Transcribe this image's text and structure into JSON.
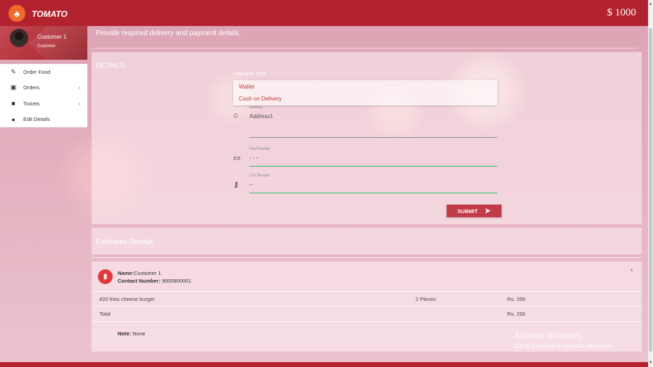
{
  "header": {
    "brand": "TOMATO",
    "balance": "$ 1000"
  },
  "profile": {
    "name": "Customer 1",
    "role": "Customer"
  },
  "sidebar": {
    "items": [
      {
        "label": "Order Food",
        "icon": "pencil-icon",
        "has_submenu": false
      },
      {
        "label": "Orders",
        "icon": "calendar-icon",
        "has_submenu": true
      },
      {
        "label": "Tickets",
        "icon": "chat-icon",
        "has_submenu": true
      },
      {
        "label": "Edit Details",
        "icon": "person-icon",
        "has_submenu": false
      }
    ]
  },
  "page": {
    "instruction": "Provide required delivery and payment details."
  },
  "details": {
    "title": "DETAILS",
    "payment_type_label": "Payment Type",
    "payment_options": [
      "Wallet",
      "Cash on Delivery"
    ],
    "address_label": "Address",
    "address_value": "Address1",
    "card_number_label": "Card Number",
    "card_number_value": "-  -  -",
    "cvv_label": "CVV Number",
    "cvv_value": "--",
    "submit_label": "SUBMIT"
  },
  "receipt": {
    "title": "Estimated Receipt",
    "name_label": "Name:",
    "name_value": "Customer 1",
    "contact_label": "Contact Number:",
    "contact_value": "9000800001",
    "items": [
      {
        "name": "#20 fries cheese burger",
        "qty": "2 Pieces",
        "price": "Rs. 200"
      }
    ],
    "total_label": "Total",
    "total_value": "Rs. 200",
    "note_label": "Note:",
    "note_value": "None"
  },
  "watermark": {
    "title": "Activate Windows",
    "subtitle": "Go to Settings to activate Windows."
  },
  "colors": {
    "header": "#b3222f",
    "accent": "#c13b48",
    "focus_line": "#2eb872"
  }
}
